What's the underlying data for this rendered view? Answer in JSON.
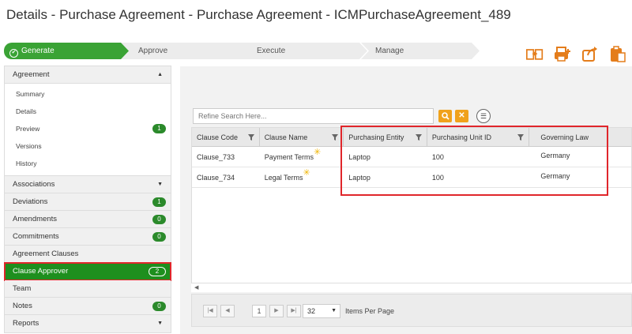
{
  "page": {
    "title": "Details - Purchase Agreement - Purchase Agreement - ICMPurchaseAgreement_489"
  },
  "workflow": {
    "steps": [
      {
        "label": "Generate",
        "state": "active"
      },
      {
        "label": "Approve",
        "state": "pending"
      },
      {
        "label": "Execute",
        "state": "pending"
      },
      {
        "label": "Manage",
        "state": "pending"
      }
    ]
  },
  "toolbar": {
    "icons": [
      "compare-docs-icon",
      "print-add-icon",
      "export-icon",
      "clipboard-icon"
    ],
    "accent": "#e47d1b"
  },
  "sidebar": {
    "agreement": {
      "label": "Agreement"
    },
    "subitems": [
      {
        "label": "Summary"
      },
      {
        "label": "Details"
      },
      {
        "label": "Preview",
        "badge": "1"
      },
      {
        "label": "Versions"
      },
      {
        "label": "History"
      }
    ],
    "sections": [
      {
        "label": "Associations",
        "caret": "▼"
      },
      {
        "label": "Deviations",
        "badge": "1"
      },
      {
        "label": "Amendments",
        "badge": "0"
      },
      {
        "label": "Commitments",
        "badge": "0"
      },
      {
        "label": "Agreement Clauses"
      },
      {
        "label": "Clause Approver",
        "badge": "2",
        "active": true
      },
      {
        "label": "Team"
      },
      {
        "label": "Notes",
        "badge": "0"
      },
      {
        "label": "Reports",
        "caret": "▼"
      }
    ],
    "active_color": "#1e8f1e"
  },
  "search": {
    "placeholder": "Refine Search Here..."
  },
  "grid": {
    "columns": [
      "Clause Code",
      "Clause Name",
      "Purchasing Entity",
      "Purchasing Unit ID",
      "Governing Law"
    ],
    "rows": [
      {
        "code": "Clause_733",
        "name": "Payment Terms",
        "entity": "Laptop",
        "unit": "100",
        "law": "Germany"
      },
      {
        "code": "Clause_734",
        "name": "Legal Terms",
        "entity": "Laptop",
        "unit": "100",
        "law": "Germany"
      }
    ]
  },
  "pager": {
    "page": "1",
    "page_size": "32",
    "label": "Items Per Page"
  },
  "highlight_color": "#e0262b"
}
